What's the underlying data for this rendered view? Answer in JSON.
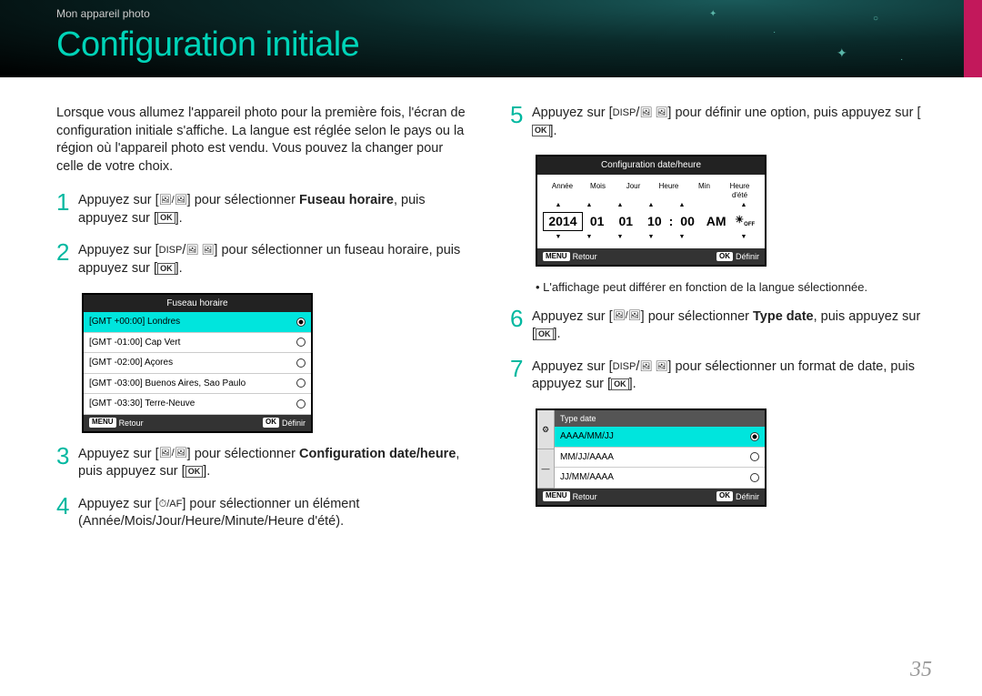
{
  "breadcrumb": "Mon appareil photo",
  "title": "Configuration initiale",
  "intro": "Lorsque vous allumez l'appareil photo pour la première fois, l'écran de configuration initiale s'affiche. La langue est réglée selon le pays ou la région où l'appareil photo est vendu. Vous pouvez la changer pour celle de votre choix.",
  "steps": {
    "s1a": "Appuyez sur [",
    "s1b": "] pour sélectionner ",
    "s1bold": "Fuseau horaire",
    "s1c": ", puis appuyez sur [",
    "s1d": "].",
    "s2a": "Appuyez sur [",
    "s2b": "] pour sélectionner un fuseau horaire, puis appuyez sur [",
    "s2c": "].",
    "s3a": "Appuyez sur [",
    "s3b": "] pour sélectionner ",
    "s3bold": "Configuration date/heure",
    "s3c": ", puis appuyez sur [",
    "s3d": "].",
    "s4a": "Appuyez sur [",
    "s4b": "] pour sélectionner un élément (Année/Mois/Jour/Heure/Minute/Heure d'été).",
    "s5a": "Appuyez sur [",
    "s5b": "] pour définir une option, puis appuyez sur [",
    "s5c": "].",
    "s6a": "Appuyez sur [",
    "s6b": "] pour sélectionner ",
    "s6bold": "Type date",
    "s6c": ", puis appuyez sur [",
    "s6d": "].",
    "s7a": "Appuyez sur [",
    "s7b": "] pour sélectionner un format de date, puis appuyez sur [",
    "s7c": "]."
  },
  "note": "L'affichage peut différer en fonction de la langue sélectionnée.",
  "tz_screen": {
    "title": "Fuseau horaire",
    "rows": [
      "[GMT +00:00] Londres",
      "[GMT -01:00] Cap Vert",
      "[GMT -02:00] Açores",
      "[GMT -03:00] Buenos Aires, Sao Paulo",
      "[GMT -03:30] Terre-Neuve"
    ],
    "back_label": "MENU",
    "back_text": "Retour",
    "ok_label": "OK",
    "ok_text": "Définir"
  },
  "date_screen": {
    "title": "Configuration date/heure",
    "labels": [
      "Année",
      "Mois",
      "Jour",
      "Heure",
      "Min",
      "Heure d'été"
    ],
    "values": [
      "2014",
      "01",
      "01",
      "10",
      "00",
      "AM"
    ],
    "back_label": "MENU",
    "back_text": "Retour",
    "ok_label": "OK",
    "ok_text": "Définir"
  },
  "type_screen": {
    "title": "Type date",
    "rows": [
      "AAAA/MM/JJ",
      "MM/JJ/AAAA",
      "JJ/MM/AAAA"
    ],
    "back_label": "MENU",
    "back_text": "Retour",
    "ok_label": "OK",
    "ok_text": "Définir"
  },
  "icons": {
    "disp": "DISP",
    "ok": "OK",
    "timer_af": "⏱/AF"
  },
  "page_num": "35"
}
